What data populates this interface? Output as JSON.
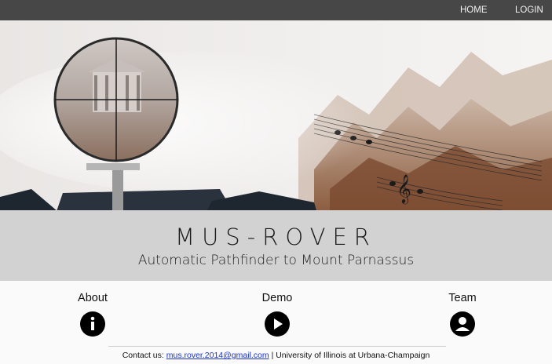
{
  "nav": {
    "home_label": "HOME",
    "login_label": "LOGIN"
  },
  "brand": {
    "title": "MUS-ROVER",
    "subtitle": "Automatic Pathfinder to Mount Parnassus"
  },
  "features": [
    {
      "label": "About",
      "icon": "info-icon"
    },
    {
      "label": "Demo",
      "icon": "play-icon"
    },
    {
      "label": "Team",
      "icon": "account-icon"
    }
  ],
  "footer": {
    "prefix": "Contact us:",
    "email": "mus.rover.2014@gmail.com",
    "suffix": "| University of Illinois at Urbana-Champaign"
  },
  "colors": {
    "topbar": "#474747",
    "banner": "#d2d2d2",
    "link": "#1a33cc"
  }
}
